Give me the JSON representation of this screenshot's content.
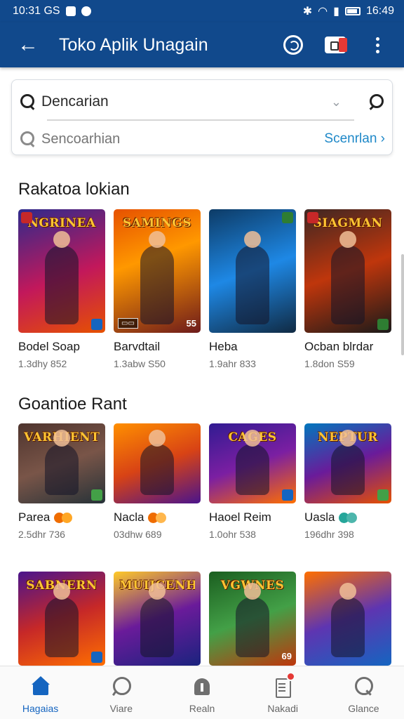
{
  "status_bar": {
    "left_text": "10:31 GS",
    "time": "16:49"
  },
  "app_bar": {
    "title": "Toko Aplik Unagain"
  },
  "search": {
    "primary_value": "Dencarian",
    "secondary_placeholder": "Sencoarhian",
    "link_label": "Scenrlan ›"
  },
  "sections": [
    {
      "title": "Rakatoa lokian",
      "items": [
        {
          "banner": "NGRINEA",
          "name": "Bodel Soap",
          "meta": "1.3dhy 852",
          "bg": "linear-gradient(160deg,#2e2a8c,#c2185b 55%,#e65100)",
          "corner": "#1565c0"
        },
        {
          "banner": "SAMINGS",
          "name": "Barvdtail",
          "meta": "1.3abw S50",
          "bg": "linear-gradient(160deg,#e65100,#ff9800 40%,#6d1b1b)",
          "tag_right": "55"
        },
        {
          "banner": "",
          "name": "Heba",
          "meta": "1.9ahr 833",
          "bg": "linear-gradient(160deg,#0d3b66,#1e88e5 50%,#102a43)",
          "corner": "#2e7d32"
        },
        {
          "banner": "SIAGMAN",
          "name": "Ocban blrdar",
          "meta": "1.8don S59",
          "bg": "linear-gradient(160deg,#3e2723,#bf360c 50%,#1a1a1a)",
          "corner": "#2e7d32"
        }
      ]
    },
    {
      "title": "Goantioe Rant",
      "items": [
        {
          "banner": "VARHIENT",
          "name": "Parea",
          "meta": "2.5dhr 736",
          "bg": "linear-gradient(160deg,#4e342e,#795548 50%,#263238)",
          "dots": [
            "#ef6c00",
            "#ffa726"
          ],
          "corner": "#43a047"
        },
        {
          "banner": "",
          "name": "Nacla",
          "meta": "03dhw 689",
          "bg": "linear-gradient(160deg,#ff8f00,#d84315 50%,#4a148c)",
          "dots": [
            "#ef6c00",
            "#ffb74d"
          ]
        },
        {
          "banner": "CAGES",
          "name": "Haoel Reim",
          "meta": "1.0ohr 538",
          "bg": "linear-gradient(160deg,#311b92,#7b1fa2 50%,#ff6f00)",
          "corner": "#1565c0"
        },
        {
          "banner": "NEPTUR",
          "name": "Uasla",
          "meta": "196dhr 398",
          "bg": "linear-gradient(160deg,#0277bd,#6a1b9a 50%,#e65100)",
          "dots": [
            "#26a69a",
            "#4db6ac"
          ],
          "corner": "#43a047"
        }
      ]
    },
    {
      "title": "",
      "items": [
        {
          "banner": "SABNERN",
          "name": "",
          "meta": "",
          "bg": "linear-gradient(160deg,#4a148c,#c62828 50%,#ff6f00)",
          "corner": "#1565c0"
        },
        {
          "banner": "MUIJCENHS",
          "name": "",
          "meta": "",
          "bg": "linear-gradient(160deg,#ffca28,#6a1b9a 50%,#1a237e)"
        },
        {
          "banner": "VGWNES",
          "name": "",
          "meta": "",
          "bg": "linear-gradient(160deg,#1b5e20,#43a047 50%,#bf360c)",
          "tag_right": "69"
        },
        {
          "banner": "",
          "name": "",
          "meta": "",
          "bg": "linear-gradient(160deg,#ff6f00,#5e35b1 50%,#1565c0)"
        }
      ]
    }
  ],
  "bottom_nav": [
    {
      "label": "Hagaias",
      "icon": "home-icon",
      "active": true
    },
    {
      "label": "Viare",
      "icon": "chat-icon"
    },
    {
      "label": "Realn",
      "icon": "tag-icon"
    },
    {
      "label": "Nakadi",
      "icon": "notes-icon",
      "badge": true
    },
    {
      "label": "Glance",
      "icon": "search-icon"
    }
  ],
  "colors": {
    "brand": "#11498c",
    "accent": "#1565c0",
    "link": "#1e88c8"
  }
}
